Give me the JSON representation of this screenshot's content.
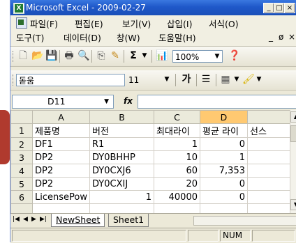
{
  "window": {
    "title": "Microsoft Excel - 2009-02-27",
    "app_icon": "excel-icon",
    "minimize_label": "_",
    "maximize_label": "□",
    "close_label": "×"
  },
  "menus": {
    "row1": [
      "파일(F)",
      "편집(E)",
      "보기(V)",
      "삽입(I)",
      "서식(O)"
    ],
    "row2": [
      "도구(T)",
      "데이터(D)",
      "창(W)",
      "도움말(H)"
    ],
    "mdi_min": "_",
    "mdi_restore": "ø",
    "mdi_close": "×"
  },
  "toolbar": {
    "sum_label": "Σ",
    "zoom_value": "100%"
  },
  "format_toolbar": {
    "font_name": "돋움",
    "font_size": "11",
    "bold_label": "가"
  },
  "formula_bar": {
    "name_box": "D11",
    "fx_label": "fx",
    "formula": ""
  },
  "sheet": {
    "columns": [
      "A",
      "B",
      "C",
      "D"
    ],
    "selected_column": "D",
    "rows": [
      {
        "num": "1",
        "cells": [
          "제품명",
          "버전",
          "최대라이",
          "평균 라이",
          "선스"
        ]
      },
      {
        "num": "2",
        "cells": [
          "DF1",
          "R1",
          "1",
          "0",
          ""
        ]
      },
      {
        "num": "3",
        "cells": [
          "DP2",
          "DY0BHHP",
          "10",
          "1",
          ""
        ]
      },
      {
        "num": "4",
        "cells": [
          "DP2",
          "DY0CXJ6",
          "60",
          "7,353",
          ""
        ]
      },
      {
        "num": "5",
        "cells": [
          "DP2",
          "DY0CXIJ",
          "20",
          "0",
          ""
        ]
      },
      {
        "num": "6",
        "cells": [
          "LicensePow",
          "1",
          "40000",
          "0",
          ""
        ]
      }
    ]
  },
  "tabs": {
    "active": "NewSheet",
    "others": [
      "Sheet1"
    ]
  },
  "status": {
    "mode": "NUM"
  }
}
